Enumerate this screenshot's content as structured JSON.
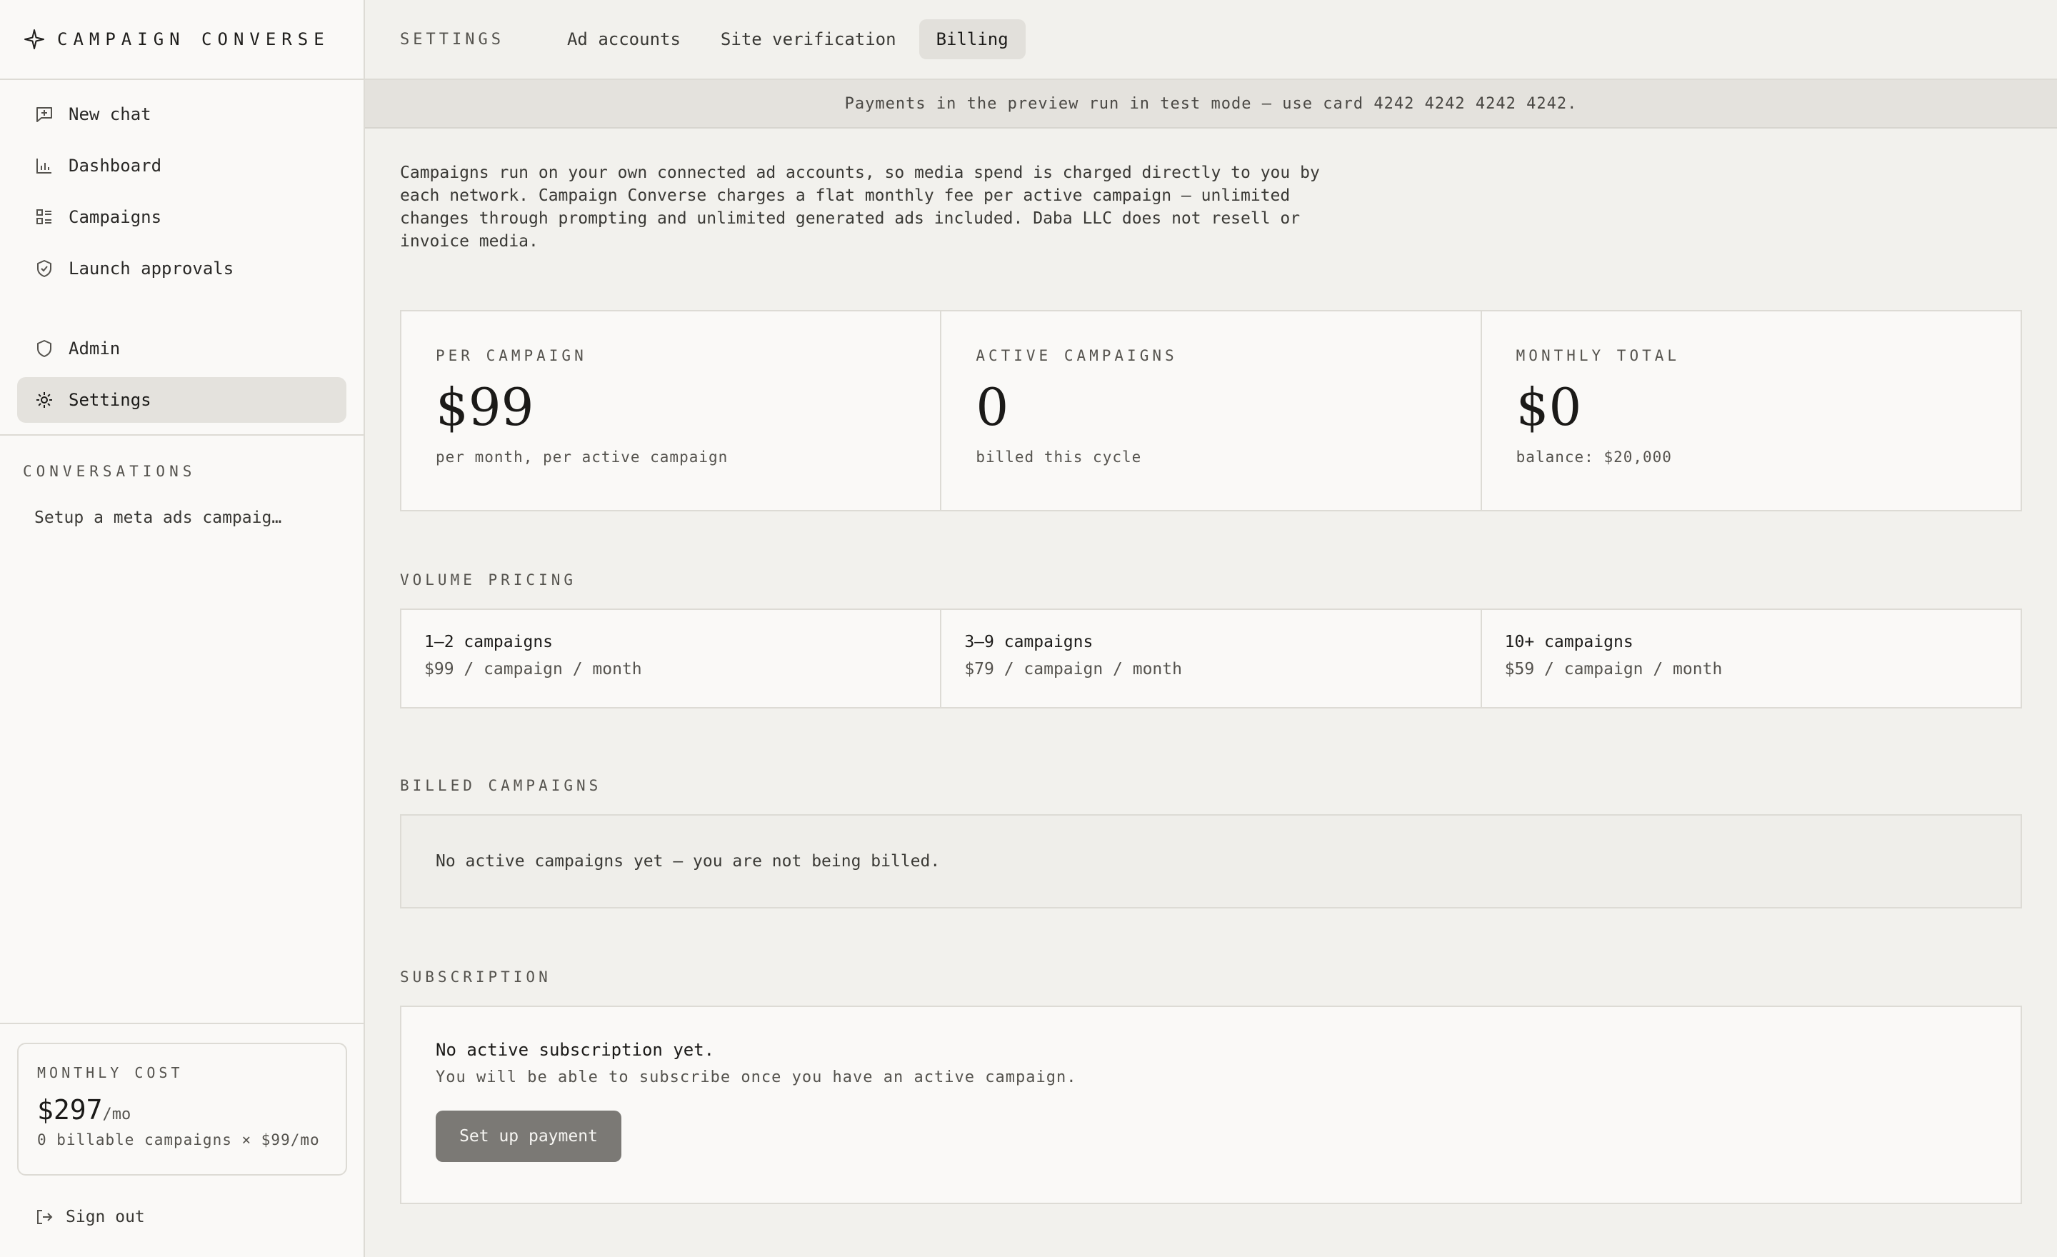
{
  "brand": {
    "name": "CAMPAIGN CONVERSE"
  },
  "sidebar": {
    "nav": [
      {
        "label": "New chat",
        "icon": "new-chat-icon"
      },
      {
        "label": "Dashboard",
        "icon": "bar-chart-icon"
      },
      {
        "label": "Campaigns",
        "icon": "list-icon"
      },
      {
        "label": "Launch approvals",
        "icon": "shield-check-icon"
      }
    ],
    "nav2": [
      {
        "label": "Admin",
        "icon": "shield-icon"
      },
      {
        "label": "Settings",
        "icon": "gear-icon",
        "active": true
      }
    ],
    "conversations_label": "CONVERSATIONS",
    "conversations": [
      {
        "label": "Setup a meta ads campaig…"
      }
    ],
    "monthly_cost": {
      "label": "MONTHLY COST",
      "value": "$297",
      "unit": "/mo",
      "detail": "0 billable campaigns × $99/mo"
    },
    "sign_out": "Sign out"
  },
  "header": {
    "section": "SETTINGS",
    "tabs": [
      {
        "label": "Ad accounts",
        "active": false
      },
      {
        "label": "Site verification",
        "active": false
      },
      {
        "label": "Billing",
        "active": true
      }
    ]
  },
  "banner": "Payments in the preview run in test mode — use card 4242 4242 4242 4242.",
  "intro": "Campaigns run on your own connected ad accounts, so media spend is charged directly to you by each network. Campaign Converse charges a flat monthly fee per active campaign — unlimited changes through prompting and unlimited generated ads included. Daba LLC does not resell or invoice media.",
  "stats": [
    {
      "label": "PER CAMPAIGN",
      "value": "$99",
      "sub": "per month, per active campaign"
    },
    {
      "label": "ACTIVE CAMPAIGNS",
      "value": "0",
      "sub": "billed this cycle"
    },
    {
      "label": "MONTHLY TOTAL",
      "value": "$0",
      "sub": "balance: $20,000"
    }
  ],
  "volume_pricing": {
    "label": "VOLUME PRICING",
    "tiers": [
      {
        "name": "1–2 campaigns",
        "price": "$99 / campaign / month"
      },
      {
        "name": "3–9 campaigns",
        "price": "$79 / campaign / month"
      },
      {
        "name": "10+ campaigns",
        "price": "$59 / campaign / month"
      }
    ]
  },
  "billed_campaigns": {
    "label": "BILLED CAMPAIGNS",
    "empty": "No active campaigns yet — you are not being billed."
  },
  "subscription": {
    "label": "SUBSCRIPTION",
    "title": "No active subscription yet.",
    "desc": "You will be able to subscribe once you have an active campaign.",
    "button": "Set up payment"
  }
}
